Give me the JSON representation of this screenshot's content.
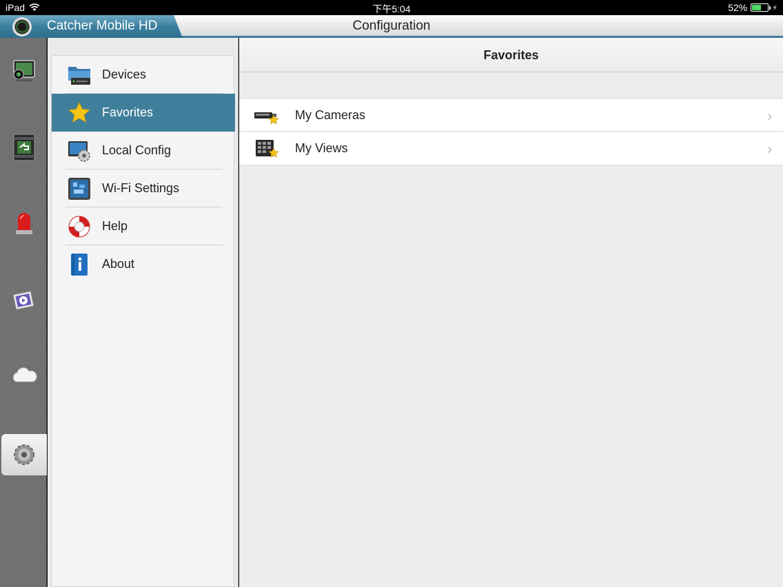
{
  "status_bar": {
    "device": "iPad",
    "time": "下午5:04",
    "battery": "52%",
    "battery_level": 0.52
  },
  "header": {
    "app_name": "Catcher Mobile HD",
    "title": "Configuration"
  },
  "rail": {
    "items": [
      {
        "icon": "live-view-icon"
      },
      {
        "icon": "playback-icon"
      },
      {
        "icon": "alarm-icon"
      },
      {
        "icon": "media-icon"
      },
      {
        "icon": "cloud-icon"
      },
      {
        "icon": "settings-icon",
        "active": true
      }
    ]
  },
  "menu": {
    "items": [
      {
        "label": "Devices",
        "icon": "devices-folder-icon"
      },
      {
        "label": "Favorites",
        "icon": "star-icon",
        "selected": true
      },
      {
        "label": "Local Config",
        "icon": "local-config-icon"
      },
      {
        "label": "Wi-Fi Settings",
        "icon": "wifi-settings-icon"
      },
      {
        "label": "Help",
        "icon": "help-lifebuoy-icon"
      },
      {
        "label": "About",
        "icon": "about-info-icon"
      }
    ]
  },
  "detail": {
    "title": "Favorites",
    "rows": [
      {
        "label": "My Cameras",
        "icon": "camera-star-icon"
      },
      {
        "label": "My Views",
        "icon": "views-grid-star-icon"
      }
    ]
  },
  "colors": {
    "accent": "#3f7f9b",
    "battery_fill": "#4cd964"
  }
}
